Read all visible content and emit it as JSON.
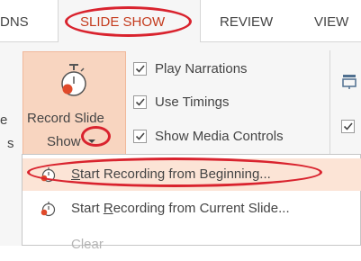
{
  "tabs": {
    "left_partial": "DNS",
    "active": "SLIDE SHOW",
    "review": "REVIEW",
    "view": "VIEW"
  },
  "ribbon": {
    "record_button": {
      "line1": "Record Slide",
      "line2": "Show"
    },
    "left_partial_top": "e",
    "left_partial_bottom": "s",
    "checkboxes": [
      {
        "label": "Play Narrations",
        "checked": true
      },
      {
        "label": "Use Timings",
        "checked": true
      },
      {
        "label": "Show Media Controls",
        "checked": true
      }
    ]
  },
  "menu": {
    "items": [
      {
        "pre": "",
        "accel": "S",
        "post": "tart Recording from Beginning...",
        "highlighted": true,
        "enabled": true,
        "icon": "record-from-beginning-icon"
      },
      {
        "pre": "Start ",
        "accel": "R",
        "post": "ecording from Current Slide...",
        "highlighted": false,
        "enabled": true,
        "icon": "record-from-current-icon"
      },
      {
        "pre": "",
        "accel": "",
        "post": "Clear",
        "highlighted": false,
        "enabled": false,
        "icon": ""
      }
    ]
  },
  "colors": {
    "accent": "#c43b1d",
    "annotation": "#d9232e",
    "highlight": "#fce4d6",
    "button_pressed": "#f8d5c0"
  }
}
